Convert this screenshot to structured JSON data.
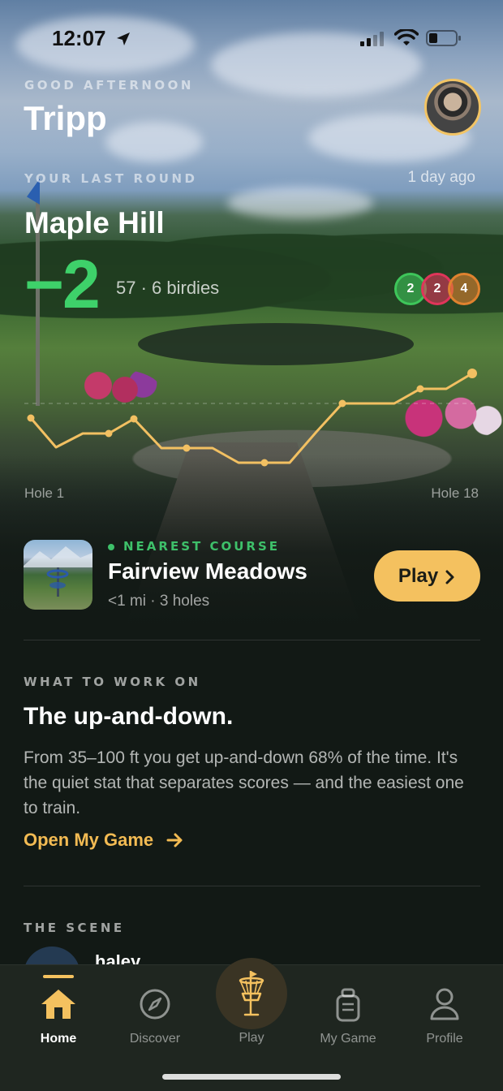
{
  "status_bar": {
    "time": "12:07"
  },
  "header": {
    "greeting": "GOOD AFTERNOON",
    "username": "Tripp"
  },
  "last_round": {
    "label": "YOUR LAST ROUND",
    "time_ago": "1 day ago",
    "course": "Maple Hill",
    "score": "−2",
    "detail": "57 · 6 birdies",
    "badges": [
      {
        "value": "2",
        "color": "#3ec65a"
      },
      {
        "value": "2",
        "color": "#e0355a"
      },
      {
        "value": "4",
        "color": "#e0822f"
      }
    ],
    "hole_start": "Hole 1",
    "hole_end": "Hole 18",
    "chart_color": "#f2c062"
  },
  "nearest_course": {
    "label": "NEAREST COURSE",
    "name": "Fairview Meadows",
    "meta": "<1 mi · 3 holes",
    "play_label": "Play"
  },
  "work_on": {
    "label": "WHAT TO WORK ON",
    "title": "The up-and-down.",
    "body": "From 35–100 ft you get up-and-down 68% of the time. It's the quiet stat that separates scores — and the easiest one to train.",
    "link": "Open My Game"
  },
  "scene": {
    "label": "THE SCENE",
    "first_user": "haley"
  },
  "tabs": [
    {
      "label": "Home",
      "icon": "home-icon",
      "active": true
    },
    {
      "label": "Discover",
      "icon": "compass-icon",
      "active": false
    },
    {
      "label": "Play",
      "icon": "disc-golf-basket-icon",
      "active": false
    },
    {
      "label": "My Game",
      "icon": "golf-bag-icon",
      "active": false
    },
    {
      "label": "Profile",
      "icon": "person-icon",
      "active": false
    }
  ],
  "colors": {
    "accent": "#f4c15f",
    "score_green": "#3ed16a",
    "course_green": "#3ec06a"
  }
}
